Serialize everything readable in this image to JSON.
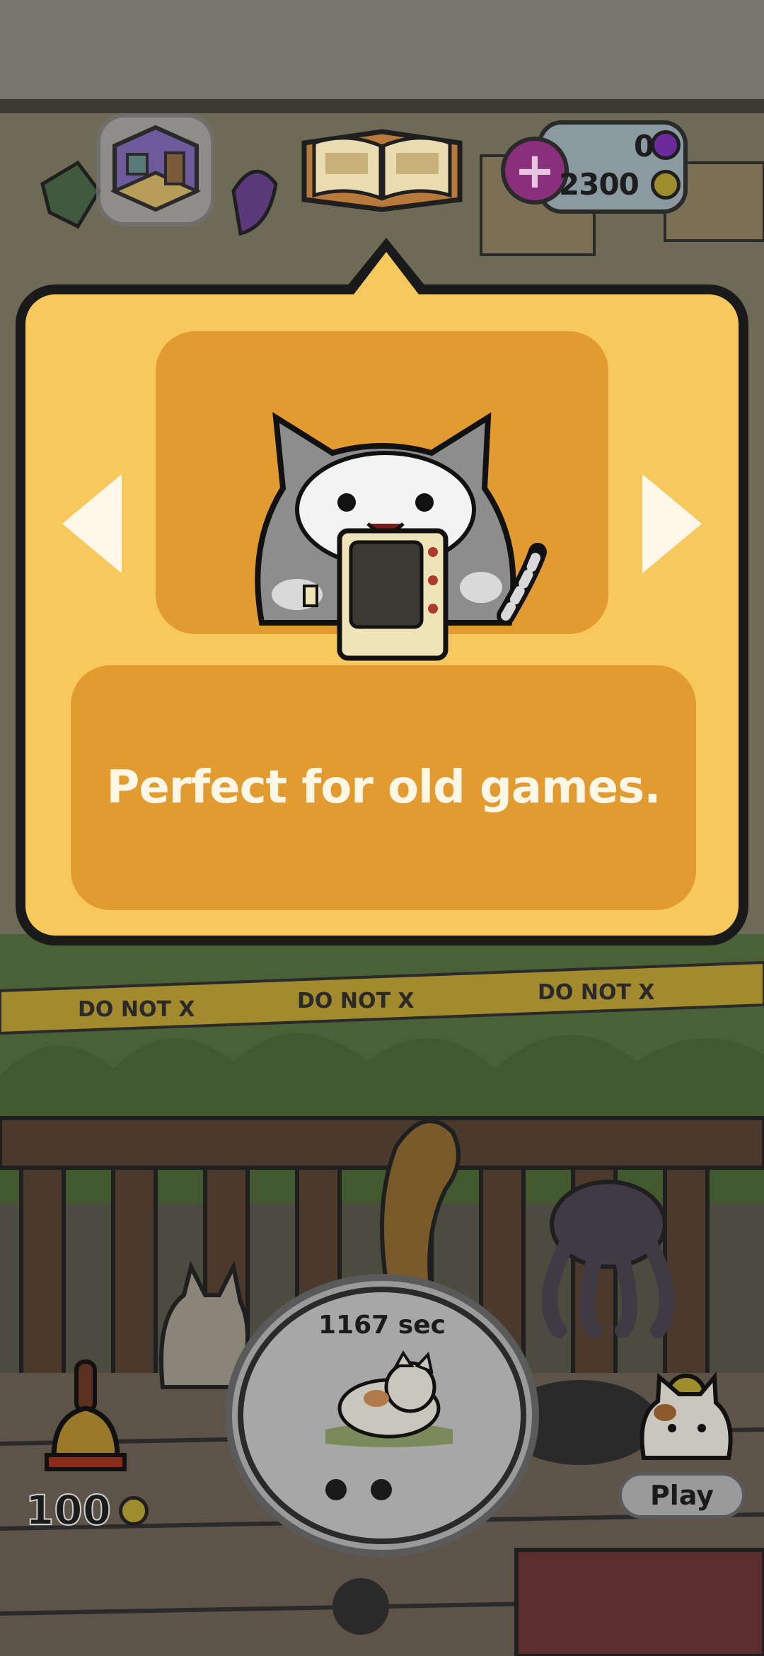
{
  "currency": {
    "gems": "0",
    "coins": "2300"
  },
  "popup": {
    "description": "Perfect for old games."
  },
  "timer": {
    "label": "1167 sec"
  },
  "bottom": {
    "bell_cost": "100",
    "play_label": "Play"
  },
  "background": {
    "tape_text_1": "DO NOT X",
    "tape_text_2": "DO NOT X",
    "tape_text_3": "DO NOT X"
  },
  "colors": {
    "popup_bg": "#f7c85b",
    "panel_bg": "#e19b31",
    "text_light": "#fff7e6",
    "dim_overlay": "#4b4b3f"
  },
  "icons": {
    "room_icon": "room-cube-icon",
    "book_icon": "open-book-icon",
    "plus_icon": "plus-icon",
    "gem_icon": "gem-icon",
    "coin_icon": "coin-icon",
    "bell_icon": "bell-icon"
  }
}
